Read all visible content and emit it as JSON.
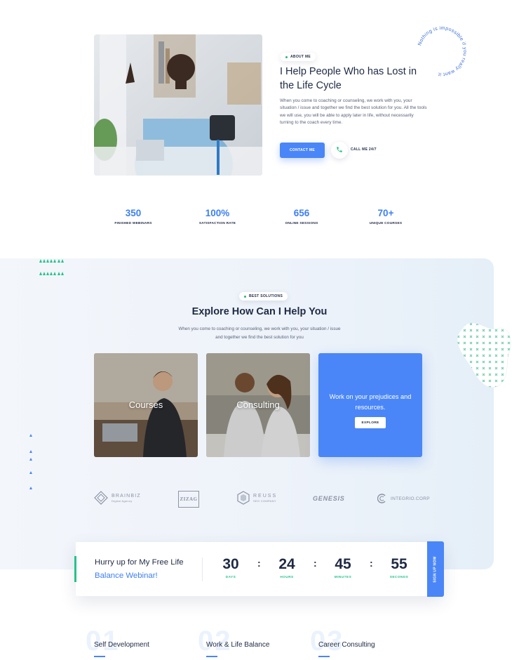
{
  "about": {
    "badge": "ABOUT ME",
    "title": "I Help People Who has Lost in the Life Cycle",
    "text": "When you come to coaching or counseling, we work with you, your situation / issue and together we find the best solution for you. All the tools we will use, you will be able to apply later in life, without necessarily turning to the coach every time.",
    "contact_button": "CONTACT ME",
    "call_label": "CALL ME 24/7",
    "circle_text": "Nothing is impossible if you really want it"
  },
  "stats": [
    {
      "value": "350",
      "label": "FINISHED WEBINARS"
    },
    {
      "value": "100%",
      "label": "SATISFACTION RATE"
    },
    {
      "value": "656",
      "label": "ONLINE SESSIONS"
    },
    {
      "value": "70+",
      "label": "UNIQUE COURSES"
    }
  ],
  "solutions": {
    "badge": "BEST SOLUTIONS",
    "title": "Explore How Can I Help You",
    "text": "When you come to coaching or counseling, we work with you, your situation / issue and together we find the best solution for you",
    "cards": [
      {
        "label": "Courses"
      },
      {
        "label": "Consulting"
      },
      {
        "label": "Work on your prejudices and resources.",
        "button": "EXPLORE"
      }
    ]
  },
  "logos": [
    {
      "name": "BRAINBIZ",
      "sub": "Digital Agency"
    },
    {
      "name": "ZIZAG"
    },
    {
      "name": "REUSS",
      "sub": "SEO COMPANY"
    },
    {
      "name": "GENESIS"
    },
    {
      "name": "INTEGRIO.CORP"
    }
  ],
  "countdown": {
    "title_part1": "Hurry up for My Free Life",
    "title_part2": "Balance Webinar!",
    "units": [
      {
        "value": "30",
        "label": "DAYS"
      },
      {
        "value": "24",
        "label": "HOURS"
      },
      {
        "value": "45",
        "label": "MINUTES"
      },
      {
        "value": "55",
        "label": "SECONDS"
      }
    ],
    "signup": "SIGN UP NOW"
  },
  "features": [
    {
      "num": "01",
      "title": "Self Development"
    },
    {
      "num": "02",
      "title": "Work & Life Balance"
    },
    {
      "num": "03",
      "title": "Career Consulting"
    }
  ],
  "colors": {
    "accent_blue": "#4a86f7",
    "accent_green": "#27c28a",
    "text_dark": "#1f2a44"
  }
}
